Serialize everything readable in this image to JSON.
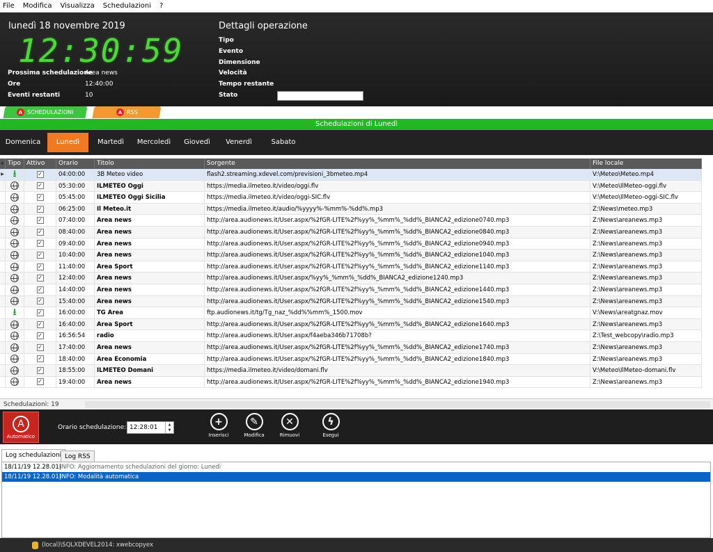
{
  "menu": [
    "File",
    "Modifica",
    "Visualizza",
    "Schedulazioni",
    "?"
  ],
  "header": {
    "date": "lunedì 18 novembre 2019",
    "clock": "12:30:59",
    "prossima_label": "Prossima schedulazione",
    "prossima_val": "Area news",
    "ore_label": "Ore",
    "ore_val": "12:40:00",
    "eventi_label": "Eventi restanti",
    "eventi_val": "10",
    "dettagli_title": "Dettagli operazione",
    "dettagli": [
      "Tipo",
      "Evento",
      "Dimensione",
      "Velocità",
      "Tempo restante",
      "Stato"
    ]
  },
  "tabs": {
    "sched": "SCHEDULAZIONI",
    "rss": "RSS",
    "badge": "A"
  },
  "green_title": "Schedulazioni di Lunedì",
  "days": [
    "Domenica",
    "Lunedì",
    "Martedì",
    "Mercoledì",
    "Giovedì",
    "Venerdì",
    "Sabato"
  ],
  "active_day": "Lunedì",
  "columns": [
    "Tipo",
    "Attivo",
    "Orario",
    "Titolo",
    "Sorgente",
    "File locale"
  ],
  "rows": [
    {
      "tipo": "download",
      "orario": "04:00:00",
      "titolo": "3B Meteo video",
      "sorgente": "flash2.streaming.xdevel.com/previsioni_3bmeteo.mp4",
      "file": "V:\\Meteo\\Meteo.mp4"
    },
    {
      "tipo": "web",
      "orario": "05:30:00",
      "titolo": "ILMETEO Oggi",
      "sorgente": "https://media.ilmeteo.it/video/oggi.flv",
      "file": "V:\\Meteo\\IlMeteo-oggi.flv"
    },
    {
      "tipo": "web",
      "orario": "05:45:00",
      "titolo": "ILMETEO Oggi Sicilia",
      "sorgente": "https://media.ilmeteo.it/video/oggi-SIC.flv",
      "file": "V:\\Meteo\\IlMeteo-oggi-SIC.flv"
    },
    {
      "tipo": "web",
      "orario": "06:25:00",
      "titolo": "Il Meteo.it",
      "sorgente": "https://media.ilmeteo.it/audio/%yyyy%-%mm%-%dd%.mp3",
      "file": "Z:\\News\\meteo.mp3"
    },
    {
      "tipo": "web",
      "orario": "07:40:00",
      "titolo": "Area news",
      "sorgente": "http://area.audionews.it/User.aspx/%2fGR-LITE%2f%yy%_%mm%_%dd%_BIANCA2_edizione0740.mp3",
      "file": "Z:\\News\\areanews.mp3"
    },
    {
      "tipo": "web",
      "orario": "08:40:00",
      "titolo": "Area news",
      "sorgente": "http://area.audionews.it/User.aspx/%2fGR-LITE%2f%yy%_%mm%_%dd%_BIANCA2_edizione0840.mp3",
      "file": "Z:\\News\\areanews.mp3"
    },
    {
      "tipo": "web",
      "orario": "09:40:00",
      "titolo": "Area news",
      "sorgente": "http://area.audionews.it/User.aspx/%2fGR-LITE%2f%yy%_%mm%_%dd%_BIANCA2_edizione0940.mp3",
      "file": "Z:\\News\\areanews.mp3"
    },
    {
      "tipo": "web",
      "orario": "10:40:00",
      "titolo": "Area news",
      "sorgente": "http://area.audionews.it/User.aspx/%2fGR-LITE%2f%yy%_%mm%_%dd%_BIANCA2_edizione1040.mp3",
      "file": "Z:\\News\\areanews.mp3"
    },
    {
      "tipo": "web",
      "orario": "11:40:00",
      "titolo": "Area Sport",
      "sorgente": "http://area.audionews.it/User.aspx/%2fGR-LITE%2f%yy%_%mm%_%dd%_BIANCA2_edizione1140.mp3",
      "file": "Z:\\News\\areanews.mp3"
    },
    {
      "tipo": "web",
      "orario": "12:40:00",
      "titolo": "Area news",
      "sorgente": "http://area.audionews.it/User.aspx/%yy%_%mm%_%dd%_BIANCA2_edizione1240.mp3",
      "file": "Z:\\News\\areanews.mp3"
    },
    {
      "tipo": "web",
      "orario": "14:40:00",
      "titolo": "Area news",
      "sorgente": "http://area.audionews.it/User.aspx/%2fGR-LITE%2f%yy%_%mm%_%dd%_BIANCA2_edizione1440.mp3",
      "file": "Z:\\News\\areanews.mp3"
    },
    {
      "tipo": "web",
      "orario": "15:40:00",
      "titolo": "Area news",
      "sorgente": "http://area.audionews.it/User.aspx/%2fGR-LITE%2f%yy%_%mm%_%dd%_BIANCA2_edizione1540.mp3",
      "file": "Z:\\News\\areanews.mp3"
    },
    {
      "tipo": "download",
      "orario": "16:00:00",
      "titolo": "TG Area",
      "sorgente": "ftp.audionews.it/tg/Tg_naz_%dd%%mm%_1500.mov",
      "file": "V:\\News\\areatgnaz.mov"
    },
    {
      "tipo": "web",
      "orario": "16:40:00",
      "titolo": "Area Sport",
      "sorgente": "http://area.audionews.it/User.aspx/%2fGR-LITE%2f%yy%_%mm%_%dd%_BIANCA2_edizione1640.mp3",
      "file": "Z:\\News\\areanews.mp3"
    },
    {
      "tipo": "web",
      "orario": "16:56:54",
      "titolo": "radio",
      "sorgente": "http://area.audionews.it/User.aspx/f4aeba346b71708b?",
      "file": "Z:\\Test_webcopy\\radio.mp3"
    },
    {
      "tipo": "web",
      "orario": "17:40:00",
      "titolo": "Area news",
      "sorgente": "http://area.audionews.it/User.aspx/%2fGR-LITE%2f%yy%_%mm%_%dd%_BIANCA2_edizione1740.mp3",
      "file": "Z:\\News\\areanews.mp3"
    },
    {
      "tipo": "web",
      "orario": "18:40:00",
      "titolo": "Area Economia",
      "sorgente": "http://area.audionews.it/User.aspx/%2fGR-LITE%2f%yy%_%mm%_%dd%_BIANCA2_edizione1840.mp3",
      "file": "Z:\\News\\areanews.mp3"
    },
    {
      "tipo": "web",
      "orario": "18:55:00",
      "titolo": "ILMETEO Domani",
      "sorgente": "https://media.ilmeteo.it/video/domani.flv",
      "file": "V:\\Meteo\\IlMeteo-domani.flv"
    },
    {
      "tipo": "web",
      "orario": "19:40:00",
      "titolo": "Area news",
      "sorgente": "http://area.audionews.it/User.aspx/%2fGR-LITE%2f%yy%_%mm%_%dd%_BIANCA2_edizione1940.mp3",
      "file": "Z:\\News\\areanews.mp3"
    }
  ],
  "grid_footer": "Schedulazioni: 19",
  "toolbar": {
    "automatico": "Automatico",
    "orario_label": "Orario schedulazione:",
    "orario_val": "12:28:01",
    "inserisci": "Inserisci",
    "modifica": "Modifica",
    "rimuovi": "Rimuovi",
    "esegui": "Esegui"
  },
  "log_tabs": [
    "Log schedulazioni",
    "Log RSS"
  ],
  "log": [
    {
      "time": "18/11/19 12.28.01|",
      "msg": "INFO: Aggiornamento schedulazioni del giorno: Lunedì"
    },
    {
      "time": "18/11/19 12.28.01|",
      "msg": "INFO: Modalità automatica"
    }
  ],
  "statusbar": "(local)\\SQLXDEVEL2014: xwebcopyex"
}
